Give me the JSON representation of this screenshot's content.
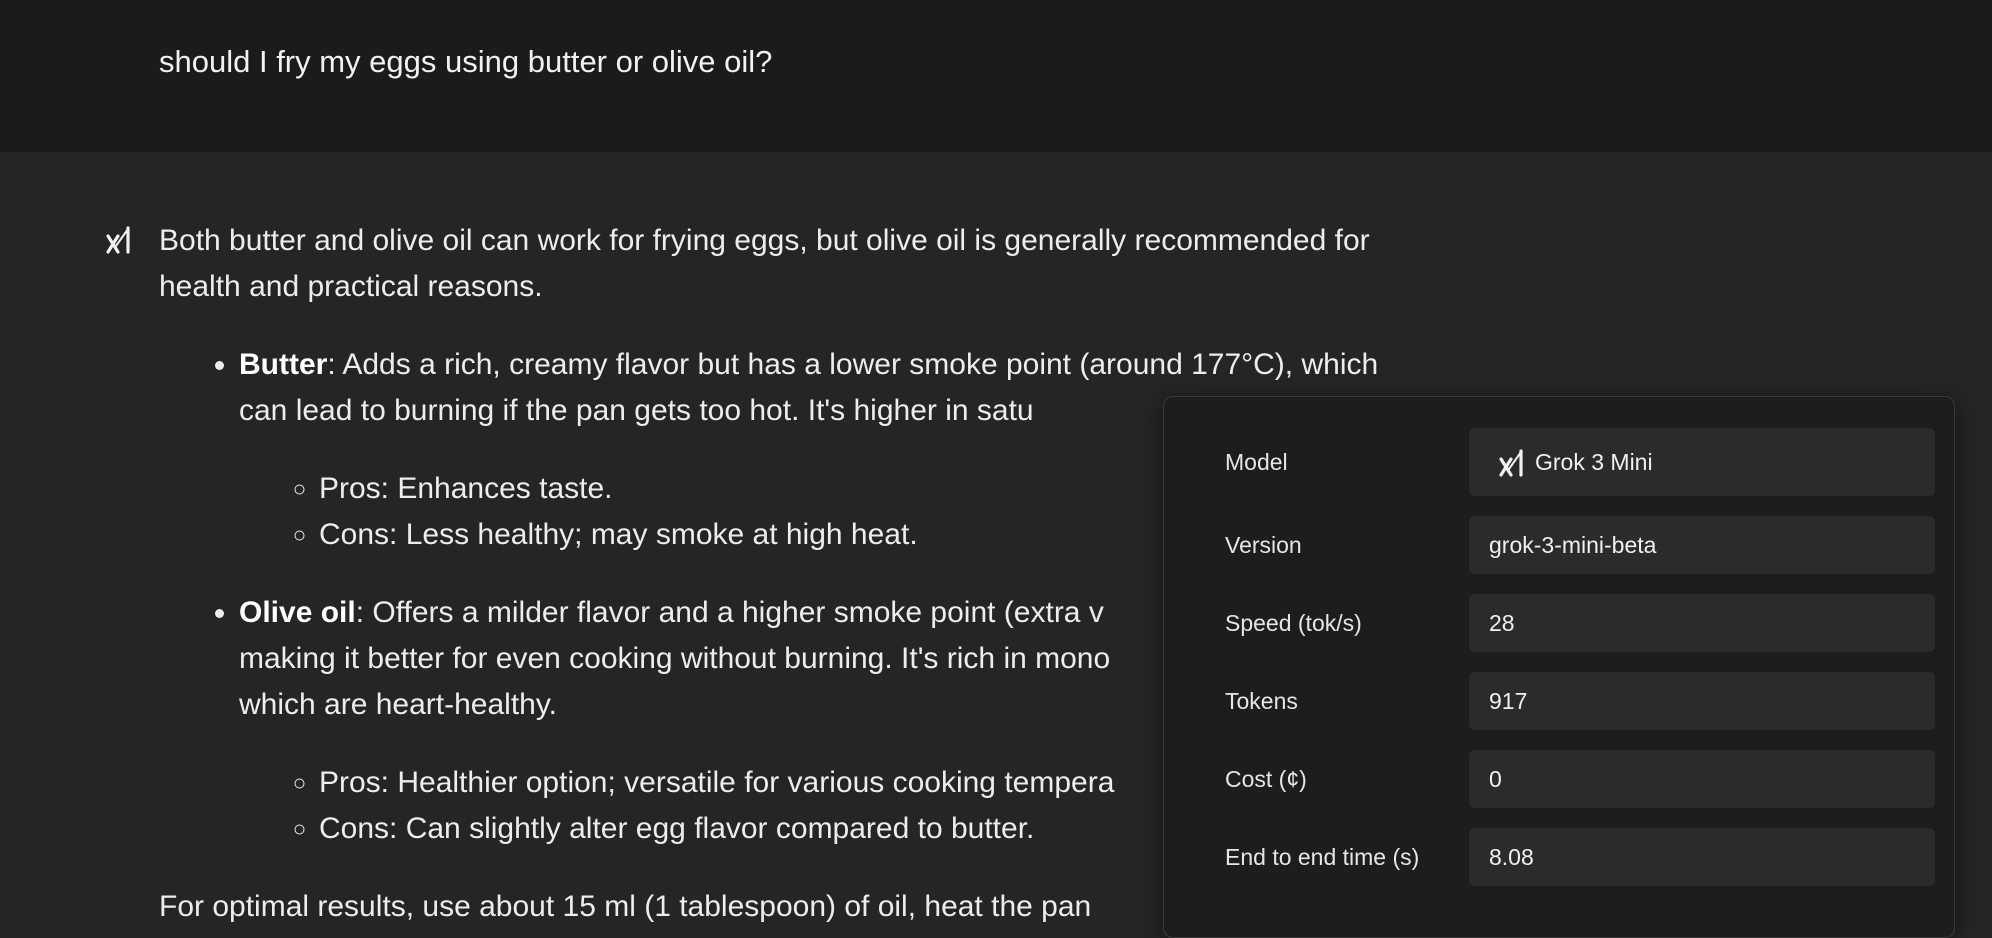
{
  "user_message": "should I fry my eggs using butter or olive oil?",
  "assistant": {
    "avatar_icon": "grok-logo-icon",
    "intro": "Both butter and olive oil can work for frying eggs, but olive oil is generally recommended for health and practical reasons.",
    "options": [
      {
        "name": "Butter",
        "text": ": Adds a rich, creamy flavor but has a lower smoke point (around 177°C), which can lead to burning if the pan gets too hot. It's higher in satu",
        "points": [
          "Pros: Enhances taste.",
          "Cons: Less healthy; may smoke at high heat."
        ]
      },
      {
        "name": "Olive oil",
        "text": ": Offers a milder flavor and a higher smoke point (extra v",
        "text_line2": "making it better for even cooking without burning. It's rich in mono",
        "text_line3": "which are heart-healthy.",
        "points": [
          "Pros: Healthier option; versatile for various cooking tempera",
          "Cons: Can slightly alter egg flavor compared to butter."
        ]
      }
    ],
    "closing": "For optimal results, use about 15 ml (1 tablespoon) of oil, heat the pan"
  },
  "info_panel": {
    "rows": [
      {
        "label": "Model",
        "value": "Grok 3 Mini",
        "icon": "grok-logo-icon"
      },
      {
        "label": "Version",
        "value": "grok-3-mini-beta"
      },
      {
        "label": "Speed (tok/s)",
        "value": "28"
      },
      {
        "label": "Tokens",
        "value": "917"
      },
      {
        "label": "Cost (¢)",
        "value": "0"
      },
      {
        "label": "End to end time (s)",
        "value": "8.08"
      }
    ]
  }
}
